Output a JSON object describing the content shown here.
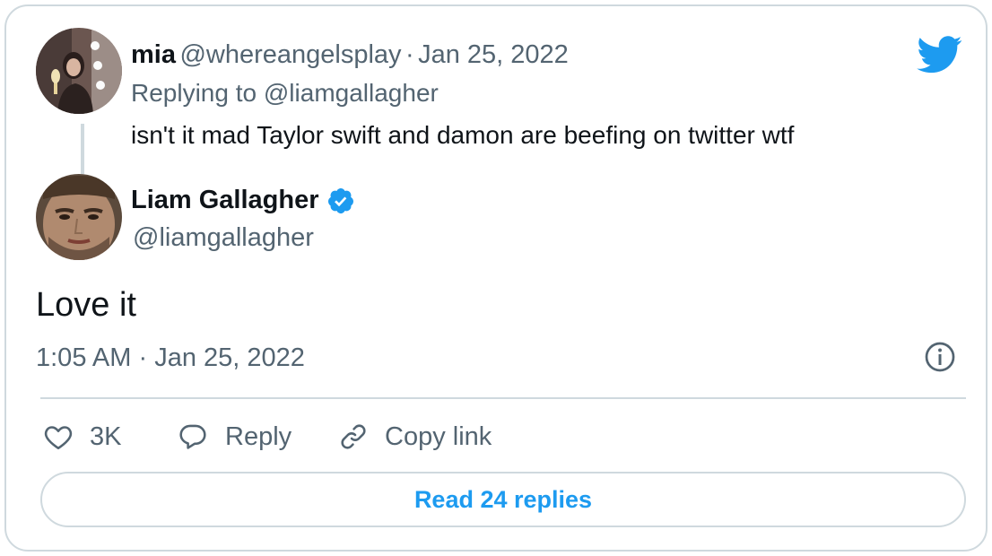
{
  "reply_tweet": {
    "name": "mia",
    "handle": "@whereangelsplay",
    "separator": "·",
    "date": "Jan 25, 2022",
    "replying_to_prefix": "Replying to",
    "replying_to_handle": "@liamgallagher",
    "text": "isn't it mad Taylor swift and damon are beefing on twitter wtf"
  },
  "main_tweet": {
    "name": "Liam Gallagher",
    "verified": true,
    "handle": "@liamgallagher",
    "text": "Love it",
    "time": "1:05 AM",
    "separator": "·",
    "date": "Jan 25, 2022"
  },
  "actions": {
    "like_count": "3K",
    "reply_label": "Reply",
    "copy_link_label": "Copy link"
  },
  "read_replies_label": "Read 24 replies",
  "icons": {
    "brand": "twitter-bird-icon",
    "verified": "verified-badge-icon",
    "info": "info-icon",
    "like": "heart-icon",
    "reply": "speech-bubble-icon",
    "copy_link": "link-icon"
  },
  "colors": {
    "twitter_blue": "#1d9bf0",
    "text": "#0f1419",
    "muted": "#536471",
    "border": "#cfd9de"
  }
}
